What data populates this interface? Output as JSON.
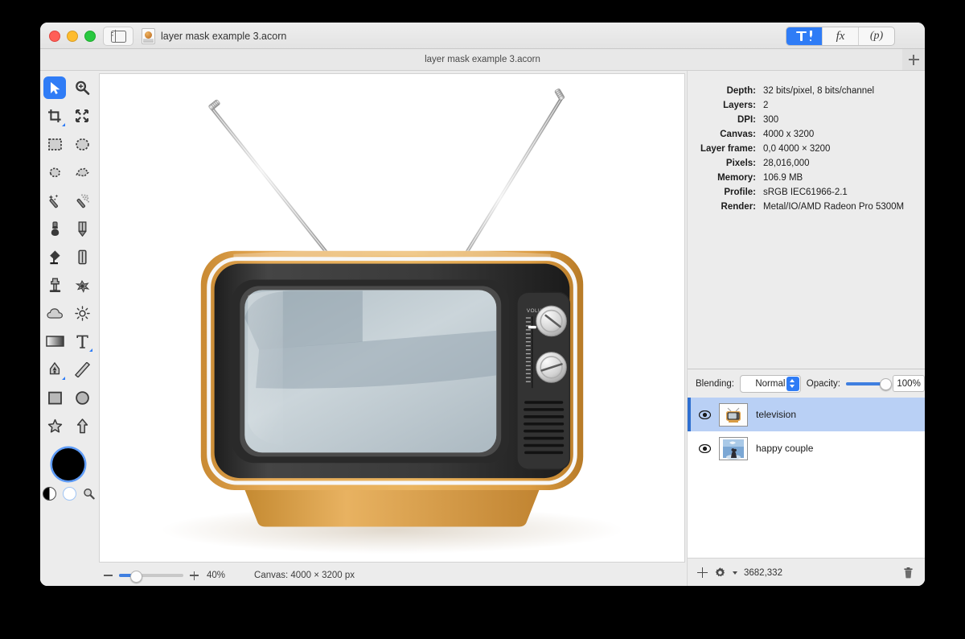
{
  "window": {
    "document_title": "layer mask example 3.acorn",
    "tab_title": "layer mask example 3.acorn",
    "traffic_lights": [
      "close-red",
      "minimize-yellow",
      "zoom-green"
    ],
    "sidebar_toggle_icon": "sidebar-toggle-icon",
    "add_tab_icon": "plus-icon",
    "segments": [
      {
        "name": "tools",
        "icon": "tools-pen-icon",
        "label": "",
        "active": true
      },
      {
        "name": "filters",
        "icon": "fx-icon",
        "label": "fx",
        "active": false
      },
      {
        "name": "palettes",
        "icon": "palette-p-icon",
        "label": "(p)",
        "active": false
      }
    ]
  },
  "tools": {
    "rows": [
      [
        {
          "name": "move-tool",
          "selected": true
        },
        {
          "name": "zoom-tool",
          "selected": false
        }
      ],
      [
        {
          "name": "crop-tool",
          "selected": false,
          "badge": true
        },
        {
          "name": "transform-tool",
          "selected": false
        }
      ],
      [
        {
          "name": "rectangular-select-tool",
          "selected": false
        },
        {
          "name": "elliptical-select-tool",
          "selected": false
        }
      ],
      [
        {
          "name": "lasso-select-tool",
          "selected": false
        },
        {
          "name": "polygon-select-tool",
          "selected": false
        }
      ],
      [
        {
          "name": "magic-wand-tool",
          "selected": false
        },
        {
          "name": "instant-alpha-tool",
          "selected": false
        }
      ],
      [
        {
          "name": "brush-tool",
          "selected": false
        },
        {
          "name": "pencil-tool",
          "selected": false
        }
      ],
      [
        {
          "name": "paint-bucket-tool",
          "selected": false
        },
        {
          "name": "eraser-tool",
          "selected": false
        }
      ],
      [
        {
          "name": "clone-stamp-tool",
          "selected": false
        },
        {
          "name": "smudge-tool",
          "selected": false
        }
      ],
      [
        {
          "name": "blur-tool",
          "selected": false
        },
        {
          "name": "dodge-tool",
          "selected": false
        }
      ],
      [
        {
          "name": "gradient-tool",
          "selected": false
        },
        {
          "name": "text-tool",
          "selected": false,
          "badge": true
        }
      ],
      [
        {
          "name": "pen-tool",
          "selected": false,
          "badge": true
        },
        {
          "name": "line-tool",
          "selected": false
        }
      ],
      [
        {
          "name": "rectangle-shape-tool",
          "selected": false
        },
        {
          "name": "ellipse-shape-tool",
          "selected": false
        }
      ],
      [
        {
          "name": "star-shape-tool",
          "selected": false
        },
        {
          "name": "arrow-shape-tool",
          "selected": false
        }
      ]
    ],
    "foreground_color": "#000000",
    "swatch_ring_color": "#5d9bf7",
    "mini": [
      "swap-colors-icon",
      "default-colors-icon",
      "color-picker-icon"
    ]
  },
  "info": {
    "rows": [
      {
        "label": "Depth:",
        "value": "32 bits/pixel, 8 bits/channel"
      },
      {
        "label": "Layers:",
        "value": "2"
      },
      {
        "label": "DPI:",
        "value": "300"
      },
      {
        "label": "Canvas:",
        "value": "4000 x 3200"
      },
      {
        "label": "Layer frame:",
        "value": "0,0 4000 × 3200"
      },
      {
        "label": "Pixels:",
        "value": "28,016,000"
      },
      {
        "label": "Memory:",
        "value": "106.9 MB"
      },
      {
        "label": "Profile:",
        "value": "sRGB IEC61966-2.1"
      },
      {
        "label": "Render:",
        "value": "Metal/IO/AMD Radeon Pro 5300M"
      }
    ]
  },
  "layers_panel": {
    "blending_label": "Blending:",
    "blending_value": "Normal",
    "opacity_label": "Opacity:",
    "opacity_value": "100%",
    "opacity_percent": 100,
    "items": [
      {
        "name": "television",
        "visible": true,
        "selected": true,
        "thumbnail": "television-thumbnail"
      },
      {
        "name": "happy couple",
        "visible": true,
        "selected": false,
        "thumbnail": "happy-couple-thumbnail"
      }
    ],
    "footer": {
      "add_icon": "plus-icon",
      "settings_icon": "gear-icon",
      "coordinates": "3682,332",
      "delete_icon": "trash-icon"
    }
  },
  "status_bar": {
    "zoom_out_icon": "minus-icon",
    "zoom_in_icon": "plus-icon",
    "zoom_value": "40%",
    "zoom_slider_percent": 25,
    "canvas_info": "Canvas: 4000 × 3200 px"
  },
  "artwork": {
    "subject": "vintage-television",
    "body_color": "#e0a34c",
    "bezel_color": "#383838",
    "screen_color": "#c2ccd2",
    "volume_label": "VOLUME",
    "antennas": 2,
    "knobs": 2
  }
}
